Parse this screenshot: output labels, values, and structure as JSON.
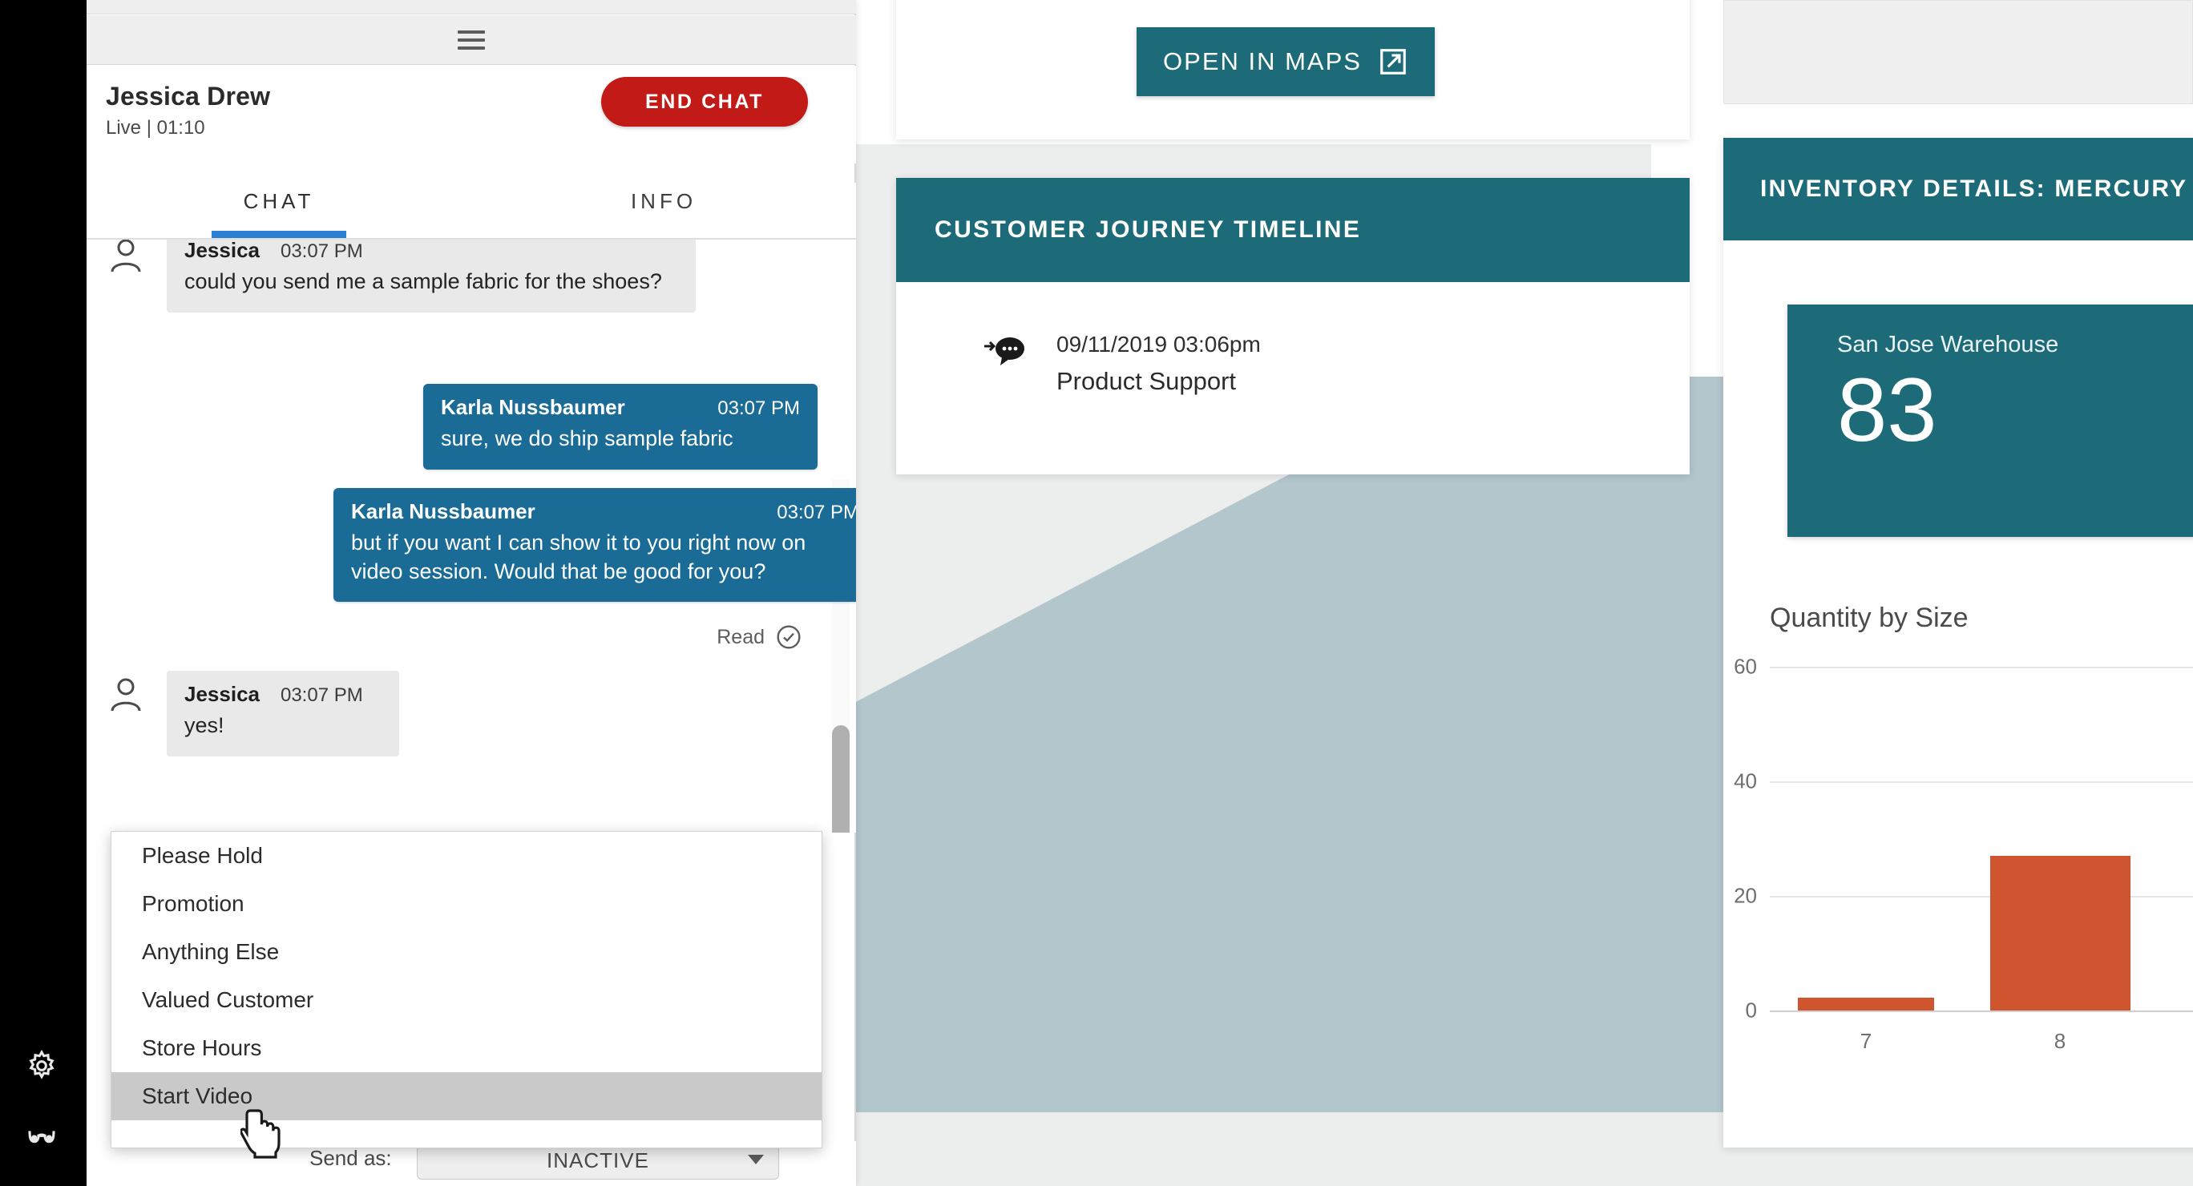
{
  "chat_panel": {
    "toolbar": {
      "menu_icon": "hamburger-icon"
    },
    "customer_name": "Jessica Drew",
    "status_line": "Live | 01:10",
    "end_chat_label": "END CHAT",
    "tabs": [
      {
        "label": "CHAT",
        "active": true
      },
      {
        "label": "INFO",
        "active": false
      }
    ],
    "messages": [
      {
        "direction": "in",
        "sender": "Jessica",
        "time": "03:07 PM",
        "text": "could you send me a sample fabric for the shoes?",
        "truncated_header": true
      },
      {
        "direction": "out",
        "sender": "Karla Nussbaumer",
        "time": "03:07 PM",
        "text": "sure, we do ship sample fabric"
      },
      {
        "direction": "out",
        "sender": "Karla Nussbaumer",
        "time": "03:07 PM",
        "text": "but if you want I can show it to you right now on video session. Would that be good for you?"
      },
      {
        "direction": "in",
        "sender": "Jessica",
        "time": "03:07 PM",
        "text": "yes!"
      }
    ],
    "read_receipt": {
      "label": "Read",
      "icon": "check-circle-icon"
    },
    "quick_replies": [
      {
        "label": "Please Hold",
        "highlighted": false
      },
      {
        "label": "Promotion",
        "highlighted": false
      },
      {
        "label": "Anything Else",
        "highlighted": false
      },
      {
        "label": "Valued Customer",
        "highlighted": false
      },
      {
        "label": "Store Hours",
        "highlighted": false
      },
      {
        "label": "Start Video",
        "highlighted": true
      }
    ],
    "send_as": {
      "label": "Send as:",
      "value": "INACTIVE"
    }
  },
  "rail": {
    "items": [
      {
        "icon": "gear-icon",
        "name": "settings"
      },
      {
        "icon": "glasses-icon",
        "name": "accessibility"
      }
    ]
  },
  "maps_card": {
    "button_label": "OPEN IN MAPS",
    "button_icon": "external-link-icon"
  },
  "timeline_card": {
    "title": "CUSTOMER JOURNEY TIMELINE",
    "entries": [
      {
        "icon": "chat-bubble-icon",
        "date": "09/11/2019 03:06pm",
        "label": "Product Support"
      }
    ]
  },
  "inventory_card": {
    "title": "INVENTORY DETAILS: MERCURY S",
    "tile": {
      "label": "San Jose Warehouse",
      "value": "83"
    },
    "chart_title": "Quantity by Size"
  },
  "colors": {
    "teal": "#1d6b78",
    "chat_blue": "#1a6c96",
    "red": "#c21a17",
    "tab_blue": "#2a7fd4",
    "bar_orange": "#cf5530",
    "bg_blue_gray": "#b3c6cc"
  },
  "chart_data": {
    "type": "bar",
    "title": "Quantity by Size",
    "categories": [
      "7",
      "8"
    ],
    "values": [
      2,
      27
    ],
    "xlabel": "",
    "ylabel": "",
    "ylim": [
      0,
      70
    ],
    "yticks": [
      0,
      20,
      40,
      60
    ],
    "grid": true,
    "legend": "none",
    "series": [
      {
        "name": "Quantity",
        "values": [
          2,
          27
        ]
      }
    ],
    "note": "chart is clipped at right edge of screenshot; additional size bars may exist off-screen"
  }
}
